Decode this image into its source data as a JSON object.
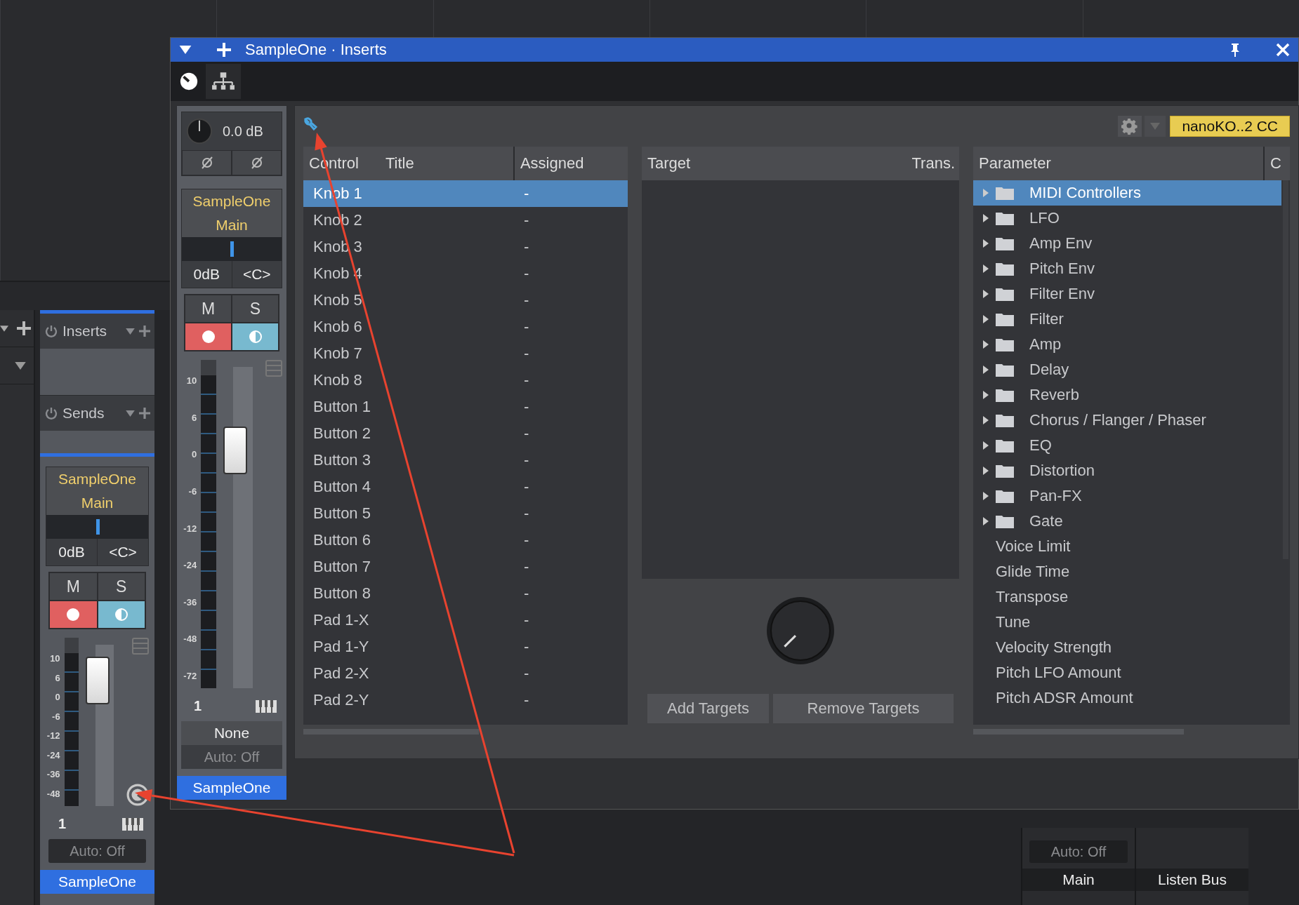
{
  "window": {
    "title": "SampleOne · Inserts"
  },
  "window_channel": {
    "volume": {
      "reading": "0.0 dB"
    },
    "send": "SampleOne",
    "output": "Main",
    "pan": {
      "level": 0.5
    },
    "gain": "0dB",
    "pan_reading": "<C>",
    "mute": "M",
    "solo": "S",
    "scale": [
      "10",
      "6",
      "0",
      "-6",
      "-12",
      "-24",
      "-36",
      "-48",
      "-72"
    ],
    "fader": {
      "level": 0.74
    },
    "number": "1",
    "input": "None",
    "automation": "Auto: Off",
    "name": "SampleOne"
  },
  "mixer_channel": {
    "inserts": "Inserts",
    "sends": "Sends",
    "send": "SampleOne",
    "output": "Main",
    "pan": {
      "level": 0.5
    },
    "gain": "0dB",
    "pan_reading": "<C>",
    "mute": "M",
    "solo": "S",
    "scale": [
      "10",
      "6",
      "0",
      "-6",
      "-12",
      "-24",
      "-36",
      "-48"
    ],
    "fader": {
      "level": 0.78
    },
    "number": "1",
    "automation": "Auto: Off",
    "name": "SampleOne"
  },
  "device": "nanoKO..2 CC",
  "control_table": {
    "columns": [
      "Control",
      "Title",
      "Assigned"
    ],
    "rows": [
      {
        "control": "Knob 1",
        "assigned": "-",
        "selected": true
      },
      {
        "control": "Knob 2",
        "assigned": "-",
        "selected": false
      },
      {
        "control": "Knob 3",
        "assigned": "-",
        "selected": false
      },
      {
        "control": "Knob 4",
        "assigned": "-",
        "selected": false
      },
      {
        "control": "Knob 5",
        "assigned": "-",
        "selected": false
      },
      {
        "control": "Knob 6",
        "assigned": "-",
        "selected": false
      },
      {
        "control": "Knob 7",
        "assigned": "-",
        "selected": false
      },
      {
        "control": "Knob 8",
        "assigned": "-",
        "selected": false
      },
      {
        "control": "Button 1",
        "assigned": "-",
        "selected": false
      },
      {
        "control": "Button 2",
        "assigned": "-",
        "selected": false
      },
      {
        "control": "Button 3",
        "assigned": "-",
        "selected": false
      },
      {
        "control": "Button 4",
        "assigned": "-",
        "selected": false
      },
      {
        "control": "Button 5",
        "assigned": "-",
        "selected": false
      },
      {
        "control": "Button 6",
        "assigned": "-",
        "selected": false
      },
      {
        "control": "Button 7",
        "assigned": "-",
        "selected": false
      },
      {
        "control": "Button 8",
        "assigned": "-",
        "selected": false
      },
      {
        "control": "Pad 1-X",
        "assigned": "-",
        "selected": false
      },
      {
        "control": "Pad 1-Y",
        "assigned": "-",
        "selected": false
      },
      {
        "control": "Pad 2-X",
        "assigned": "-",
        "selected": false
      },
      {
        "control": "Pad 2-Y",
        "assigned": "-",
        "selected": false
      }
    ]
  },
  "target_table": {
    "columns": [
      "Target",
      "Trans."
    ],
    "buttons": [
      "Add Targets",
      "Remove Targets"
    ]
  },
  "parameter_tree": {
    "columns": [
      "Parameter",
      "C"
    ],
    "items": [
      {
        "label": "MIDI Controllers",
        "kind": "folder",
        "expanded": false,
        "selected": true
      },
      {
        "label": "LFO",
        "kind": "folder",
        "expanded": false,
        "selected": false
      },
      {
        "label": "Amp Env",
        "kind": "folder",
        "expanded": false,
        "selected": false
      },
      {
        "label": "Pitch Env",
        "kind": "folder",
        "expanded": false,
        "selected": false
      },
      {
        "label": "Filter Env",
        "kind": "folder",
        "expanded": false,
        "selected": false
      },
      {
        "label": "Filter",
        "kind": "folder",
        "expanded": false,
        "selected": false
      },
      {
        "label": "Amp",
        "kind": "folder",
        "expanded": false,
        "selected": false
      },
      {
        "label": "Delay",
        "kind": "folder",
        "expanded": false,
        "selected": false
      },
      {
        "label": "Reverb",
        "kind": "folder",
        "expanded": false,
        "selected": false
      },
      {
        "label": "Chorus / Flanger / Phaser",
        "kind": "folder",
        "expanded": false,
        "selected": false
      },
      {
        "label": "EQ",
        "kind": "folder",
        "expanded": false,
        "selected": false
      },
      {
        "label": "Distortion",
        "kind": "folder",
        "expanded": false,
        "selected": false
      },
      {
        "label": "Pan-FX",
        "kind": "folder",
        "expanded": false,
        "selected": false
      },
      {
        "label": "Gate",
        "kind": "folder",
        "expanded": false,
        "selected": false
      },
      {
        "label": "Voice Limit",
        "kind": "parameter",
        "selected": false
      },
      {
        "label": "Glide Time",
        "kind": "parameter",
        "selected": false
      },
      {
        "label": "Transpose",
        "kind": "parameter",
        "selected": false
      },
      {
        "label": "Tune",
        "kind": "parameter",
        "selected": false
      },
      {
        "label": "Velocity Strength",
        "kind": "parameter",
        "selected": false
      },
      {
        "label": "Pitch LFO Amount",
        "kind": "parameter",
        "selected": false
      },
      {
        "label": "Pitch ADSR Amount",
        "kind": "parameter",
        "selected": false
      }
    ]
  },
  "bottom_strips": [
    {
      "automation": "Auto: Off",
      "name": "Main"
    },
    {
      "name": "Listen Bus"
    }
  ]
}
